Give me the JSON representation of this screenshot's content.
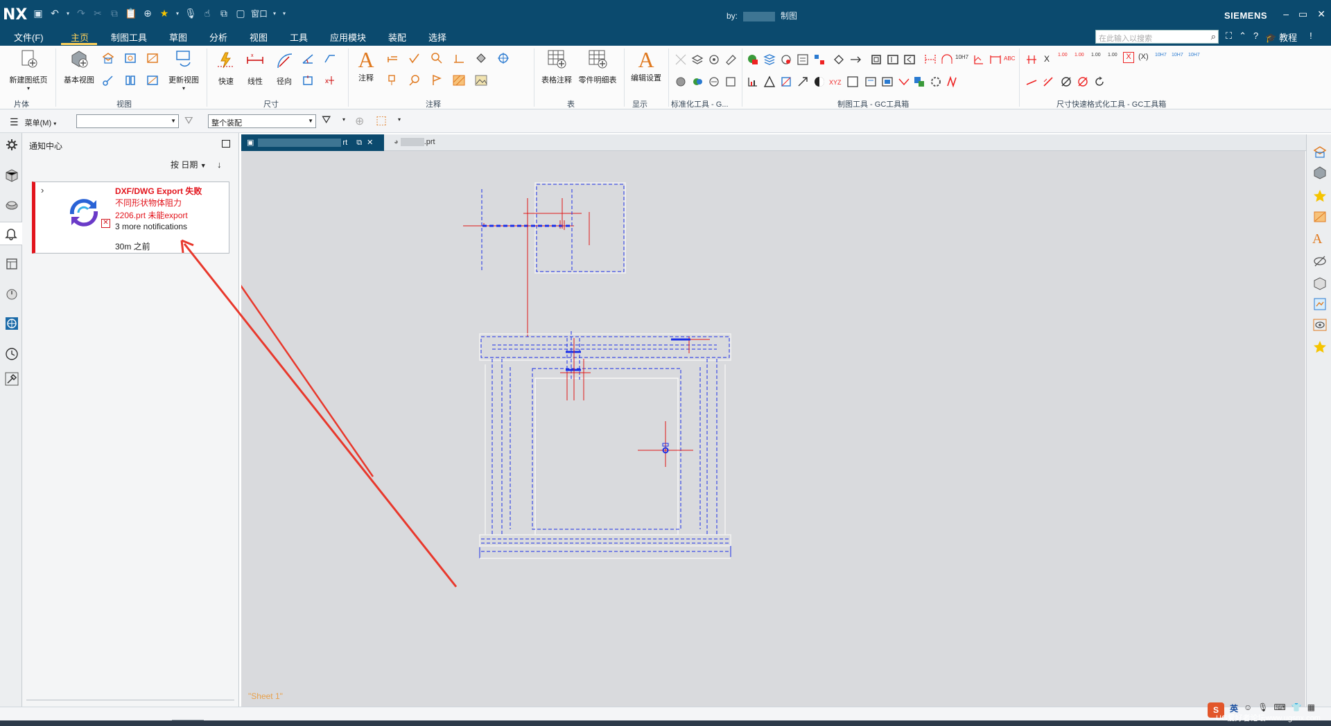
{
  "titlebar": {
    "app_logo": "NX",
    "by_label": "by:",
    "doc_mode": "制图",
    "window_menu": "窗口",
    "brand": "SIEMENS",
    "minimize": "–",
    "restore": "▭",
    "close": "✕"
  },
  "menubar": {
    "tabs": [
      "文件(F)",
      "主页",
      "制图工具",
      "草图",
      "分析",
      "视图",
      "工具",
      "应用模块",
      "装配",
      "选择"
    ],
    "active_tab": "主页",
    "search_placeholder": "在此输入以搜索",
    "tutorial_label": "教程"
  },
  "ribbon": {
    "buttons": {
      "new_sheet": "新建图纸页",
      "base_view": "基本视图",
      "update_view": "更新视图",
      "quick": "快速",
      "linear": "线性",
      "radial": "径向",
      "note": "注释",
      "table_note": "表格注释",
      "parts_list": "零件明细表",
      "edit_settings": "编辑设置"
    },
    "groups": {
      "sheet": "片体",
      "view": "视图",
      "dimension": "尺寸",
      "annotation": "注释",
      "table": "表",
      "display": "显示",
      "std_tools": "标准化工具 - G...",
      "drafting_gc": "制图工具 - GC工具箱",
      "dim_quick_format": "尺寸快速格式化工具 - GC工具箱"
    },
    "gc_labels": [
      "1.00",
      "1.00",
      "1.00",
      "1.00",
      "(X)",
      "10H7",
      "10H7",
      "10H7",
      "10H7",
      "ABC",
      "XYZ",
      "X"
    ]
  },
  "selbar": {
    "menu_label": "菜单(M)",
    "filter_value": "",
    "scope_value": "整个装配"
  },
  "notification_center": {
    "title": "通知中心",
    "sort_label": "按 日期",
    "card": {
      "title": "DXF/DWG Export 失败",
      "line1": "不同形状物体阻力",
      "line2": "2206.prt 未能export",
      "more": "3 more notifications",
      "time": "30m 之前"
    }
  },
  "doc_tabs": {
    "tab1_suffix": "rt",
    "tab2_suffix": ".prt"
  },
  "canvas": {
    "sheet_label": "\"Sheet 1\""
  },
  "tray": {
    "ime": "英",
    "info_text": "UG爱好者论坛www.ugsnx.com"
  },
  "colors": {
    "titlebar_bg": "#0b4a6e",
    "active_tab": "#ffd25a",
    "error_red": "#e2141c",
    "drawing_blue": "#1a2fe8",
    "drawing_red": "#e01818",
    "canvas_bg": "#d9dadd",
    "sheet_label": "#e8a04a"
  }
}
